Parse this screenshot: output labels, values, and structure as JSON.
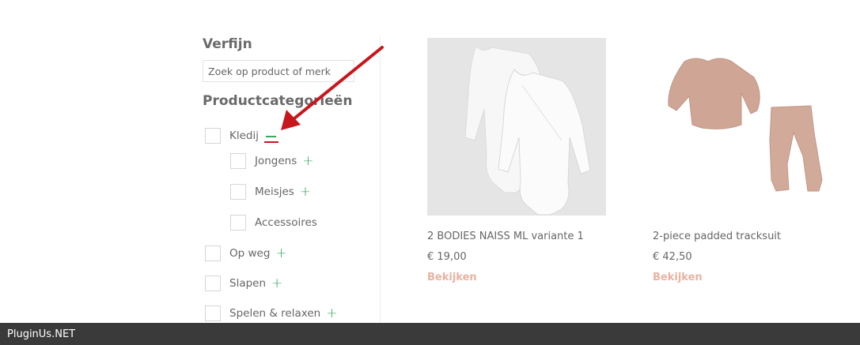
{
  "sidebar": {
    "refine_title": "Verfijn",
    "search": {
      "placeholder": "Zoek op product of merk",
      "value": ""
    },
    "categories_title": "Productcategorieën",
    "categories": [
      {
        "label": "Kledij",
        "expanded": true
      },
      {
        "label": "Jongens",
        "expanded": false
      },
      {
        "label": "Meisjes",
        "expanded": false
      },
      {
        "label": "Accessoires"
      },
      {
        "label": "Op weg",
        "expanded": false
      },
      {
        "label": "Slapen",
        "expanded": false
      },
      {
        "label": "Spelen & relaxen",
        "expanded": false
      }
    ]
  },
  "products": [
    {
      "name": "2 BODIES NAISS ML variante 1",
      "price": "€ 19,00",
      "cta": "Bekijken"
    },
    {
      "name": "2-piece padded tracksuit",
      "price": "€ 42,50",
      "cta": "Bekijken"
    }
  ],
  "footer": {
    "text": "PluginUs.NET"
  },
  "colors": {
    "accent_green": "#3aa55e",
    "cta_pink": "#e8b2a1",
    "arrow_red": "#c8161d",
    "footer_bg": "#3a3a3a"
  }
}
